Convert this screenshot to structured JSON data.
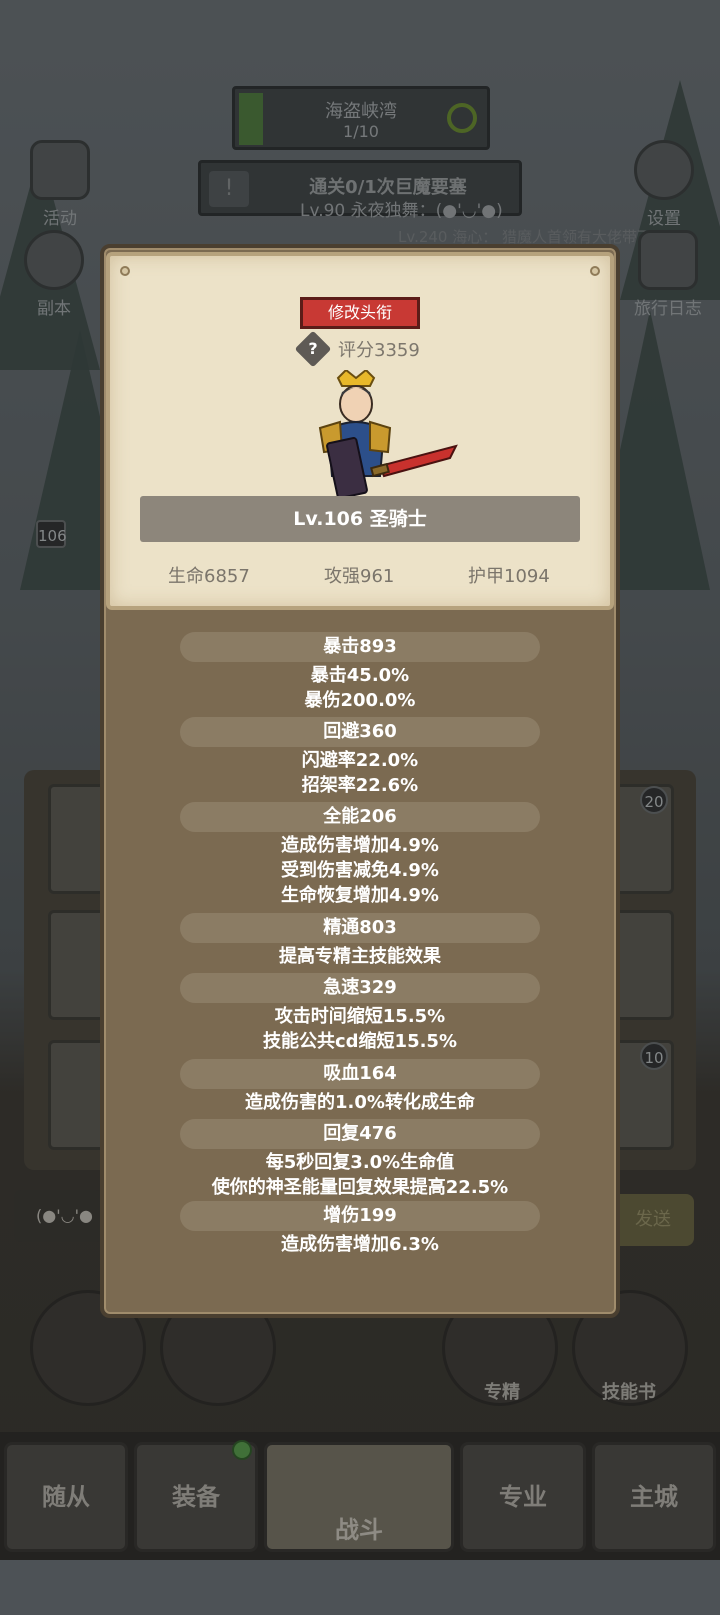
{
  "background": {
    "stage": {
      "name": "海盗峡湾",
      "progress": "1/10"
    },
    "quest": {
      "alert": "!",
      "text": "通关0/1次巨魔要塞"
    },
    "subtitle": "Lv.90 永夜独舞：(●'◡'●)",
    "chat_line": "Lv.240 海心：  猎魔人首领有大佬带下",
    "side_buttons": {
      "activity": "活动",
      "dungeon": "副本",
      "settings": "设置",
      "journal": "旅行日志"
    },
    "level_badge": "106",
    "badges": [
      "20",
      "10"
    ],
    "chat_emoji": "(●'◡'●",
    "send_label": "发送",
    "round_buttons": {
      "specialize": "专精",
      "skill_book": "技能书"
    },
    "tabs": [
      "随从",
      "装备",
      "战斗",
      "专业",
      "主城"
    ]
  },
  "character": {
    "edit_title_label": "修改头衔",
    "help_icon": "?",
    "score": "评分3359",
    "name": "Lv.106 圣骑士",
    "hp": "生命6857",
    "attack": "攻强961",
    "armor": "护甲1094"
  },
  "attributes": [
    {
      "head": "暴击893",
      "lines": [
        "暴击45.0%",
        "暴伤200.0%"
      ]
    },
    {
      "head": "回避360",
      "lines": [
        "闪避率22.0%",
        "招架率22.6%"
      ]
    },
    {
      "head": "全能206",
      "lines": [
        "造成伤害增加4.9%",
        "受到伤害减免4.9%",
        "生命恢复增加4.9%"
      ]
    },
    {
      "head": "精通803",
      "lines": [
        "提高专精主技能效果"
      ]
    },
    {
      "head": "急速329",
      "lines": [
        "攻击时间缩短15.5%",
        "技能公共cd缩短15.5%"
      ]
    },
    {
      "head": "吸血164",
      "lines": [
        "造成伤害的1.0%转化成生命"
      ]
    },
    {
      "head": "回复476",
      "lines": [
        "每5秒回复3.0%生命值",
        "使你的神圣能量回复效果提高22.5%"
      ]
    },
    {
      "head": "增伤199",
      "lines": [
        "造成伤害增加6.3%"
      ]
    }
  ]
}
